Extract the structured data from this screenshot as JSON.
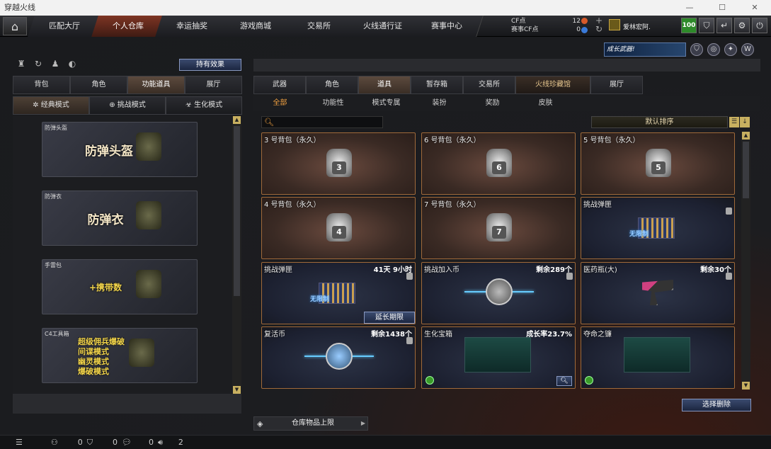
{
  "window": {
    "title": "穿越火线",
    "minimize": "—",
    "maximize": "☐",
    "close": "✕"
  },
  "topnav": {
    "home_icon": "home-icon",
    "tabs": [
      "匹配大厅",
      "个人仓库",
      "幸运抽奖",
      "游戏商城",
      "交易所",
      "火线通行证",
      "赛事中心"
    ],
    "active_tab": "个人仓库",
    "cf_label": "CF点",
    "event_cf_label": "赛事CF点",
    "cf_value": "12",
    "event_cf_value": "0",
    "username": "爱林宏阿.",
    "level_badge": "100",
    "brand_accent": "#7e3524"
  },
  "left": {
    "effect_button": "持有效果",
    "tabs": [
      "背包",
      "角色",
      "功能道具",
      "展厅"
    ],
    "active_tab": "功能道具",
    "modes": [
      "经典模式",
      "挑战模式",
      "生化模式"
    ],
    "active_mode": "经典模式",
    "items": [
      {
        "caption": "防弹头盔",
        "label": "防弹头盔"
      },
      {
        "caption": "防弹衣",
        "label": "防弹衣"
      },
      {
        "caption": "手雷包",
        "label": "+携带数"
      },
      {
        "caption": "C4工具箱",
        "lines": [
          "超级佣兵爆破",
          "间谍模式",
          "幽灵模式",
          "爆破模式"
        ]
      }
    ]
  },
  "right": {
    "growth_badge": "成长武器!",
    "tabs": [
      "武器",
      "角色",
      "道具",
      "暂存箱",
      "交易所",
      "火线珍藏馆",
      "展厅"
    ],
    "active_tab": "道具",
    "subtabs": [
      "全部",
      "功能性",
      "模式专属",
      "装扮",
      "奖励",
      "皮肤"
    ],
    "active_subtab": "全部",
    "search_placeholder": "",
    "sort_label": "默认排序",
    "cards": [
      {
        "name": "3 号背包（永久）",
        "right": "",
        "bag": "3"
      },
      {
        "name": "6 号背包（永久）",
        "right": "",
        "bag": "6"
      },
      {
        "name": "5 号背包（永久）",
        "right": "",
        "bag": "5"
      },
      {
        "name": "4 号背包（永久）",
        "right": "",
        "bag": "4"
      },
      {
        "name": "7 号背包（永久）",
        "right": "",
        "bag": "7"
      },
      {
        "name": "挑战弹匣",
        "right": "",
        "ammo_label": "无限制"
      },
      {
        "name": "挑战弹匣",
        "right": "41天 9小时",
        "ammo_label": "无限制",
        "action": "延长期限"
      },
      {
        "name": "挑战加入币",
        "right": "剩余289个"
      },
      {
        "name": "医药瓶(大)",
        "right": "剩余30个"
      },
      {
        "name": "复活币",
        "right": "剩余1438个"
      },
      {
        "name": "生化宝箱",
        "right": "成长率23.7%"
      },
      {
        "name": "夺命之镰",
        "right": ""
      }
    ],
    "delete_button": "选择删除",
    "storage_label": "仓库物品上限"
  },
  "statusbar": {
    "c1": "0",
    "c2": "0",
    "c3": "0",
    "c4": "2"
  }
}
